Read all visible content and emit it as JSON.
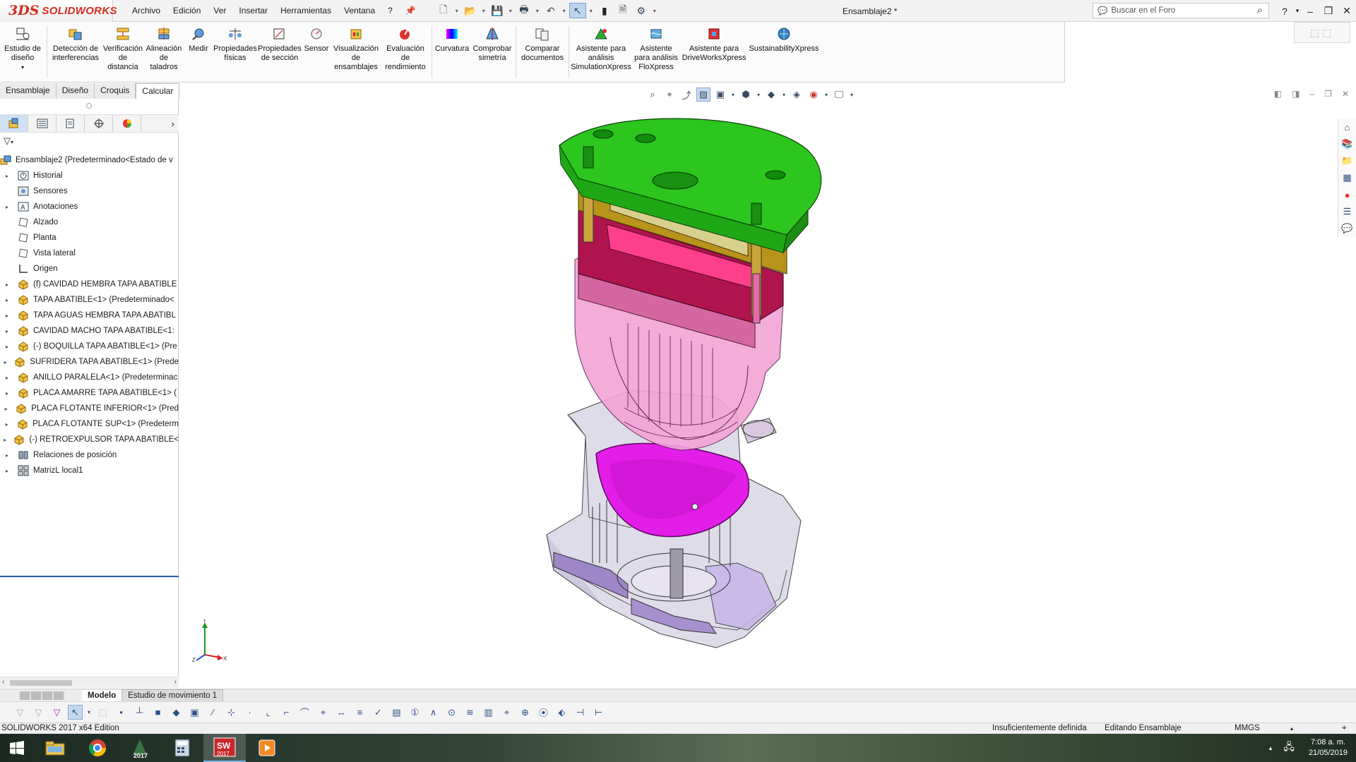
{
  "app": {
    "logo_prefix": "3DS",
    "logo_text": "SOLIDWORKS",
    "document_title": "Ensamblaje2 *",
    "search_placeholder": "Buscar en el Foro"
  },
  "menu": [
    "Archivo",
    "Edición",
    "Ver",
    "Insertar",
    "Herramientas",
    "Ventana",
    "?"
  ],
  "ribbon": [
    {
      "label": "Estudio de diseño",
      "icon": "design-study-icon"
    },
    {
      "label": "Detección de interferencias",
      "icon": "interference-icon"
    },
    {
      "label": "Verificación de distancia",
      "icon": "clearance-icon"
    },
    {
      "label": "Alineación de taladros",
      "icon": "hole-align-icon"
    },
    {
      "label": "Medir",
      "icon": "measure-icon"
    },
    {
      "label": "Propiedades físicas",
      "icon": "mass-props-icon"
    },
    {
      "label": "Propiedades de sección",
      "icon": "section-props-icon"
    },
    {
      "label": "Sensor",
      "icon": "sensor-icon"
    },
    {
      "label": "Visualización de ensamblajes",
      "icon": "assembly-viz-icon"
    },
    {
      "label": "Evaluación de rendimiento",
      "icon": "performance-icon"
    },
    {
      "label": "Curvatura",
      "icon": "curvature-icon"
    },
    {
      "label": "Comprobar simetría",
      "icon": "symmetry-icon"
    },
    {
      "label": "Comparar documentos",
      "icon": "compare-icon"
    },
    {
      "label": "Asistente para análisis SimulationXpress",
      "icon": "simxpress-icon"
    },
    {
      "label": "Asistente para análisis FloXpress",
      "icon": "floxpress-icon"
    },
    {
      "label": "Asistente para DriveWorksXpress",
      "icon": "driveworks-icon"
    },
    {
      "label": "SustainabilityXpress",
      "icon": "sustainability-icon"
    }
  ],
  "cm_tabs": [
    "Ensamblaje",
    "Diseño",
    "Croquis",
    "Calcular"
  ],
  "cm_tab_active": "Calcular",
  "tree": [
    {
      "label": "Ensamblaje2  (Predeterminado<Estado de v",
      "type": "assembly",
      "expand": false,
      "root": true
    },
    {
      "label": "Historial",
      "type": "history",
      "expand": true
    },
    {
      "label": "Sensores",
      "type": "sensor",
      "expand": false
    },
    {
      "label": "Anotaciones",
      "type": "annotation",
      "expand": true
    },
    {
      "label": "Alzado",
      "type": "plane",
      "expand": false
    },
    {
      "label": "Planta",
      "type": "plane",
      "expand": false
    },
    {
      "label": "Vista lateral",
      "type": "plane",
      "expand": false
    },
    {
      "label": "Origen",
      "type": "origin",
      "expand": false
    },
    {
      "label": "(f) CAVIDAD HEMBRA TAPA ABATIBLE",
      "type": "part",
      "expand": true
    },
    {
      "label": "TAPA ABATIBLE<1> (Predeterminado<",
      "type": "part",
      "expand": true
    },
    {
      "label": "TAPA AGUAS HEMBRA TAPA ABATIBL",
      "type": "part",
      "expand": true
    },
    {
      "label": "CAVIDAD MACHO TAPA ABATIBLE<1:",
      "type": "part",
      "expand": true
    },
    {
      "label": "(-) BOQUILLA TAPA ABATIBLE<1> (Pre",
      "type": "part",
      "expand": true
    },
    {
      "label": "SUFRIDERA TAPA ABATIBLE<1> (Prede",
      "type": "part",
      "expand": true
    },
    {
      "label": "ANILLO PARALELA<1> (Predeterminac",
      "type": "part",
      "expand": true
    },
    {
      "label": "PLACA AMARRE TAPA ABATIBLE<1> (",
      "type": "part",
      "expand": true
    },
    {
      "label": "PLACA FLOTANTE INFERIOR<1> (Pred",
      "type": "part",
      "expand": true
    },
    {
      "label": "PLACA FLOTANTE SUP<1> (Predeterm",
      "type": "part",
      "expand": true
    },
    {
      "label": "(-) RETROEXPULSOR  TAPA ABATIBLE<",
      "type": "part",
      "expand": true
    },
    {
      "label": "Relaciones de posición",
      "type": "mates",
      "expand": true
    },
    {
      "label": "MatrizL local1",
      "type": "pattern",
      "expand": true
    }
  ],
  "bottom_tabs": [
    "Modelo",
    "Estudio de movimiento 1"
  ],
  "status": {
    "edition": "SOLIDWORKS 2017 x64 Edition",
    "definition": "Insuficientemente definida",
    "mode": "Editando Ensamblaje",
    "units": "MMGS"
  },
  "taskbar": {
    "time": "7:08 a. m.",
    "date": "21/05/2019",
    "apps": [
      "file-explorer-icon",
      "chrome-icon",
      "solidworks-2017-icon",
      "calculator-icon",
      "solidworks-active-icon",
      "media-player-icon"
    ]
  },
  "colors": {
    "brand_red": "#d52b1e",
    "plate_green": "#2cc61e",
    "cavity_magenta": "#e21ee8",
    "plate_pink": "#ff3f8c",
    "plate_gold": "#b8941c"
  }
}
